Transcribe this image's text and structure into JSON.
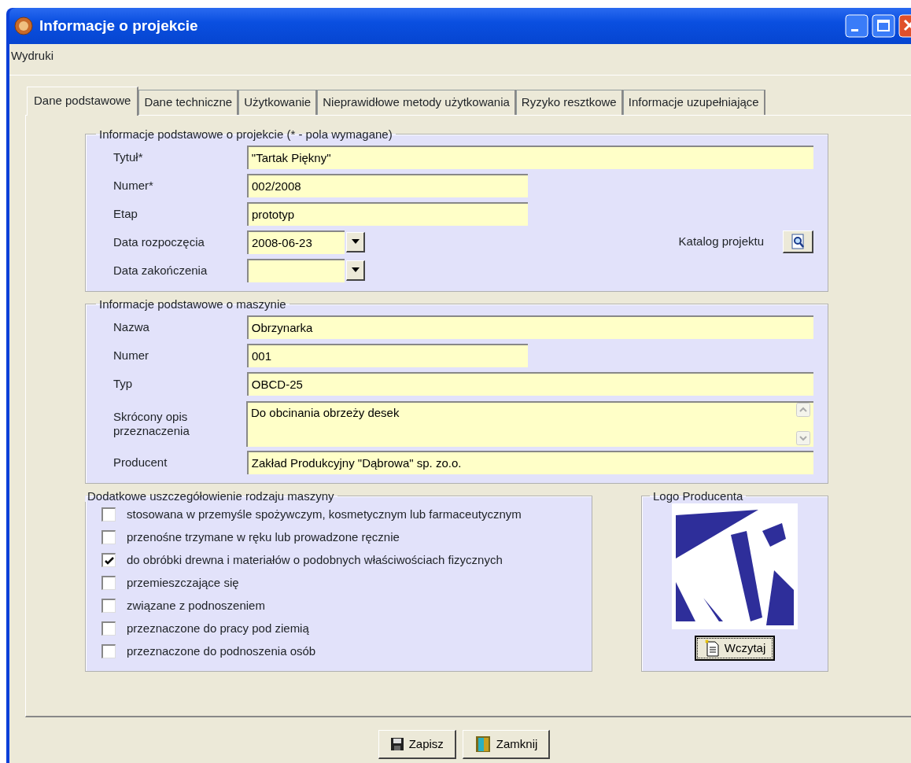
{
  "window": {
    "title": "Informacje o projekcie"
  },
  "menu": [
    "Wydruki"
  ],
  "tabs": [
    {
      "label": "Dane podstawowe",
      "selected": true
    },
    {
      "label": "Dane techniczne",
      "selected": false
    },
    {
      "label": "Użytkowanie",
      "selected": false
    },
    {
      "label": "Nieprawidłowe metody użytkowania",
      "selected": false
    },
    {
      "label": "Ryzyko resztkowe",
      "selected": false
    },
    {
      "label": "Informacje uzupełniające",
      "selected": false
    }
  ],
  "project": {
    "legend": "Informacje podstawowe o projekcie (* - pola wymagane)",
    "fields": [
      {
        "kind": "wide",
        "label": "Tytuł*",
        "value": "\"Tartak Piękny\""
      },
      {
        "kind": "short",
        "label": "Numer*",
        "value": "002/2008"
      },
      {
        "kind": "short",
        "label": "Etap",
        "value": "prototyp"
      },
      {
        "kind": "date",
        "label": "Data rozpoczęcia",
        "value": "2008-06-23"
      },
      {
        "kind": "date",
        "label": "Data zakończenia"
      }
    ],
    "catalog": {
      "label": "Katalog projektu"
    }
  },
  "machine": {
    "legend": "Informacje podstawowe o maszynie",
    "fields": [
      {
        "kind": "wide",
        "label": "Nazwa",
        "value": "Obrzynarka"
      },
      {
        "kind": "short",
        "label": "Numer",
        "value": "001"
      },
      {
        "kind": "wide",
        "label": "Typ",
        "value": "OBCD-25"
      },
      {
        "kind": "memo",
        "label": "Skrócony opis przeznaczenia",
        "value": "Do obcinania obrzeży desek"
      },
      {
        "kind": "wide",
        "label": "Producent",
        "value": "Zakład Produkcyjny \"Dąbrowa\" sp. zo.o."
      }
    ]
  },
  "details": {
    "legend": "Dodatkowe uszczegółowienie rodzaju maszyny",
    "options": [
      {
        "label": "stosowana w przemyśle spożywczym, kosmetycznym lub farmaceutycznym",
        "checked": false
      },
      {
        "label": "przenośne trzymane w ręku lub prowadzone ręcznie",
        "checked": false
      },
      {
        "label": "do obróbki drewna i materiałów o podobnych właściwościach fizycznych",
        "checked": true
      },
      {
        "label": "przemieszczające się",
        "checked": false
      },
      {
        "label": "związane z podnoszeniem",
        "checked": false
      },
      {
        "label": "przeznaczone do pracy pod ziemią",
        "checked": false
      },
      {
        "label": "przeznaczone do podnoszenia osób",
        "checked": false
      }
    ]
  },
  "logo": {
    "legend": "Logo Producenta",
    "button": "Wczytaj"
  },
  "buttons": [
    {
      "kind": "save",
      "label": "Zapisz"
    },
    {
      "kind": "close",
      "label": "Zamknij"
    }
  ]
}
